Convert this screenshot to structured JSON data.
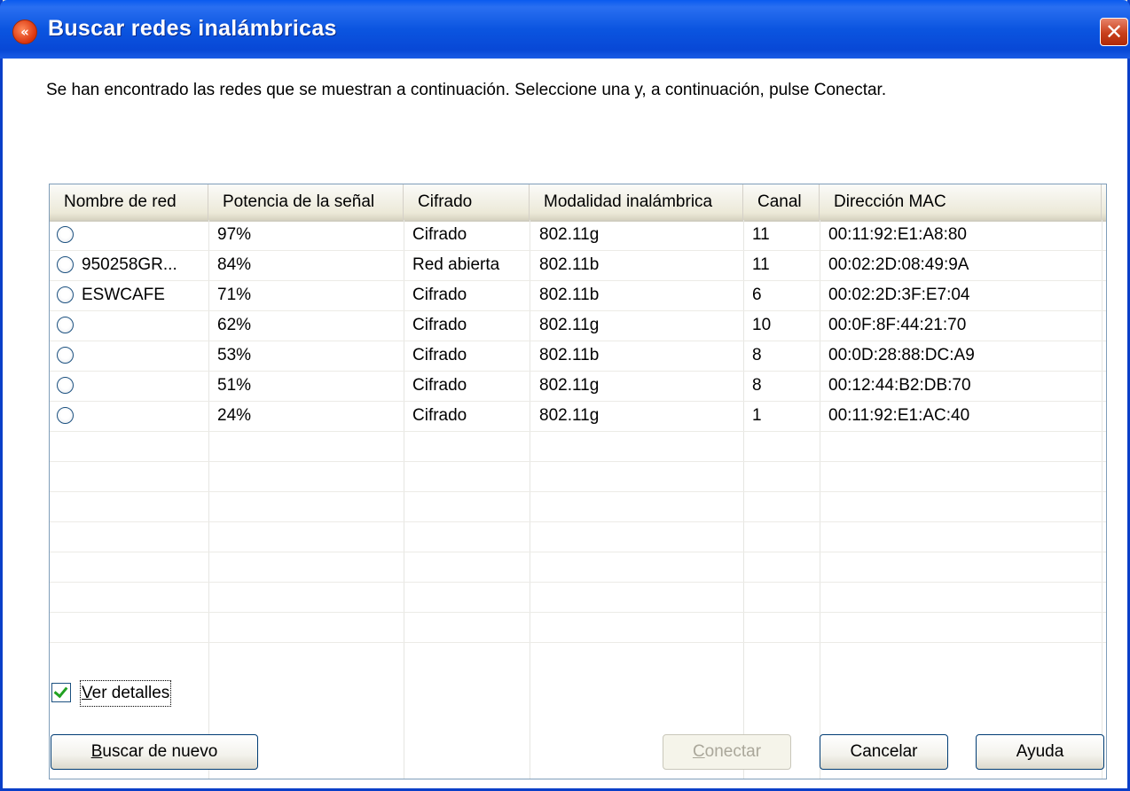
{
  "window": {
    "title": "Buscar redes inalámbricas",
    "close_glyph": "✕",
    "icon_glyph": "«"
  },
  "instruction": "Se han encontrado las redes que se muestran a continuación. Seleccione una y, a continuación, pulse Conectar.",
  "columns": [
    "Nombre de red",
    "Potencia de la señal",
    "Cifrado",
    "Modalidad inalámbrica",
    "Canal",
    "Dirección MAC"
  ],
  "networks": [
    {
      "name": "",
      "signal": "97%",
      "encryption": "Cifrado",
      "mode": "802.11g",
      "channel": "11",
      "mac": "00:11:92:E1:A8:80"
    },
    {
      "name": "950258GR...",
      "signal": "84%",
      "encryption": "Red abierta",
      "mode": "802.11b",
      "channel": "11",
      "mac": "00:02:2D:08:49:9A"
    },
    {
      "name": "ESWCAFE",
      "signal": "71%",
      "encryption": "Cifrado",
      "mode": "802.11b",
      "channel": "6",
      "mac": "00:02:2D:3F:E7:04"
    },
    {
      "name": "",
      "signal": "62%",
      "encryption": "Cifrado",
      "mode": "802.11g",
      "channel": "10",
      "mac": "00:0F:8F:44:21:70"
    },
    {
      "name": "",
      "signal": "53%",
      "encryption": "Cifrado",
      "mode": "802.11b",
      "channel": "8",
      "mac": "00:0D:28:88:DC:A9"
    },
    {
      "name": "",
      "signal": "51%",
      "encryption": "Cifrado",
      "mode": "802.11g",
      "channel": "8",
      "mac": "00:12:44:B2:DB:70"
    },
    {
      "name": "",
      "signal": "24%",
      "encryption": "Cifrado",
      "mode": "802.11g",
      "channel": "1",
      "mac": "00:11:92:E1:AC:40"
    }
  ],
  "details_checkbox": {
    "label_first": "V",
    "label_rest": "er detalles",
    "checked": true
  },
  "buttons": {
    "search_again": {
      "first": "B",
      "rest": "uscar de nuevo"
    },
    "connect": {
      "first": "C",
      "rest": "onectar",
      "disabled": true
    },
    "cancel": "Cancelar",
    "help": "Ayuda"
  },
  "colors": {
    "title_bar": "#0a5bef",
    "close_button": "#c8401c",
    "check_mark": "#21a121",
    "list_border": "#7f9db9"
  }
}
